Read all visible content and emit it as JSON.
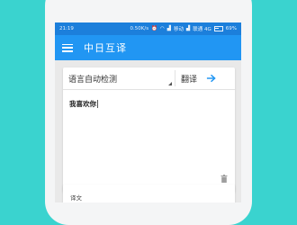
{
  "status_bar": {
    "time": "21:19",
    "speed": "0.50K/s",
    "carrier1": "移动",
    "carrier2": "联通 4G",
    "battery": "69%"
  },
  "app_bar": {
    "title": "中日互译",
    "menu_icon": "menu-icon"
  },
  "translator": {
    "source_language": "语言自动检测",
    "translate_label": "翻译",
    "input_text": "我喜欢你",
    "result_label": "译文"
  },
  "colors": {
    "background": "#3ad3cf",
    "status_bar": "#1c7fdb",
    "app_bar": "#2196f3",
    "accent": "#2196f3"
  }
}
